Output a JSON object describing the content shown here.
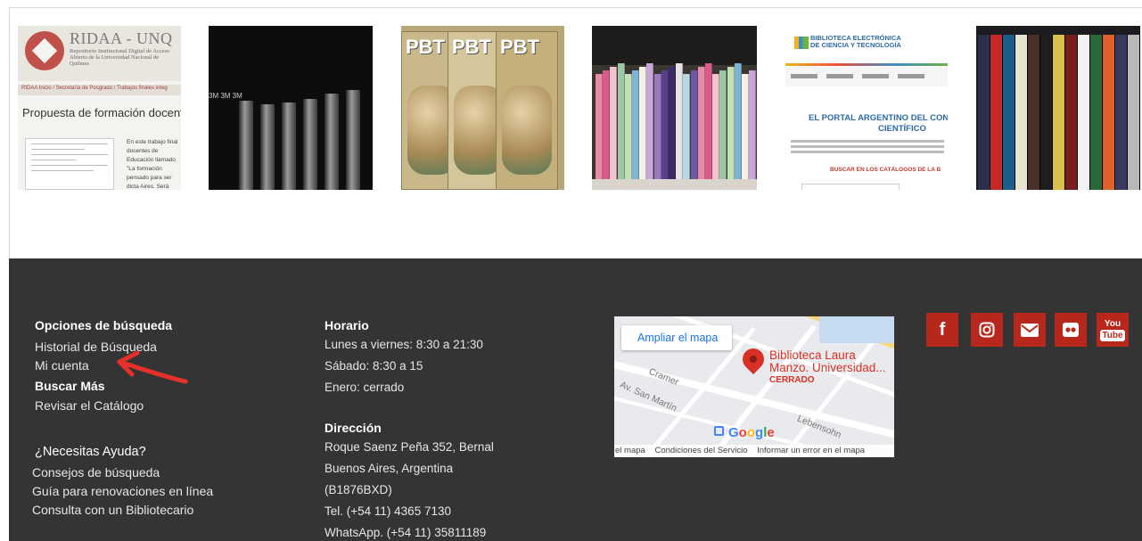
{
  "thumbnails": {
    "ridaa": {
      "title": "RIDAA - UNQ",
      "subtitle": "Repositorio Institucional Digital de Acceso Abierto de la Universidad Nacional de Quilmes",
      "breadcrumb": "RIDAA Inicio / Secretaría de Posgrado / Trabajos finales integ",
      "heading": "Propuesta de formación docente oficios y la animación de propues",
      "snippet": "En este trabajo final docentes de Educación llamado \"La formación pensado para ser dicta Aires. Será bimestral propósito del curso es reflexionar sobre a y"
    },
    "tapes_label": "3M 3M 3M",
    "pbt_label": "PBT",
    "biblioteca": {
      "title_line1": "BIBLIOTECA ELECTRÓNICA",
      "title_line2": "DE CIENCIA Y TECNOLOGÍA",
      "portal_line1": "EL PORTAL ARGENTINO DEL CON",
      "portal_line2": "CIENTÍFICO",
      "search": "BUSCAR EN LOS CATÁLOGOS DE LA B"
    }
  },
  "footer": {
    "search_options": {
      "title": "Opciones de búsqueda",
      "history": "Historial de Búsqueda",
      "account": "Mi cuenta",
      "search_more_title": "Buscar Más",
      "catalog": "Revisar el Catálogo"
    },
    "help": {
      "title": "¿Necesitas Ayuda?",
      "tips": "Consejos de búsqueda",
      "renewals": "Guía para renovaciones en línea",
      "librarian": "Consulta con un Bibliotecario"
    },
    "schedule": {
      "title": "Horario",
      "weekdays": "Lunes a viernes: 8:30 a 21:30",
      "saturday": "Sábado: 8:30 a 15",
      "january": "Enero: cerrado"
    },
    "address": {
      "title": "Dirección",
      "street": "Roque Saenz Peña 352, Bernal",
      "city": "Buenos Aires, Argentina",
      "postal": "(B1876BXD)",
      "phone": "Tel. (+54 11) 4365 7130",
      "whatsapp": "WhatsApp. (+54 11) 35811189"
    },
    "map": {
      "expand": "Ampliar el mapa",
      "place_line1": "Biblioteca Laura",
      "place_line2": "Manzo. Universidad...",
      "status": "CERRADO",
      "street1": "Cramer",
      "street2": "Av. San Martín",
      "street3": "Lebensohn",
      "brand": "Google",
      "footer_map": "el mapa",
      "footer_terms": "Condiciones del Servicio",
      "footer_report": "Informar un error en el mapa"
    },
    "social_icons": [
      "facebook-icon",
      "instagram-icon",
      "email-icon",
      "flickr-icon",
      "youtube-icon"
    ],
    "youtube_text_top": "You",
    "youtube_text_bottom": "Tube",
    "facebook_glyph": "f"
  },
  "colors": {
    "footer_bg": "#343434",
    "social_bg": "#b8271b",
    "annotation_arrow": "#e8302a",
    "map_pin": "#d93025"
  }
}
